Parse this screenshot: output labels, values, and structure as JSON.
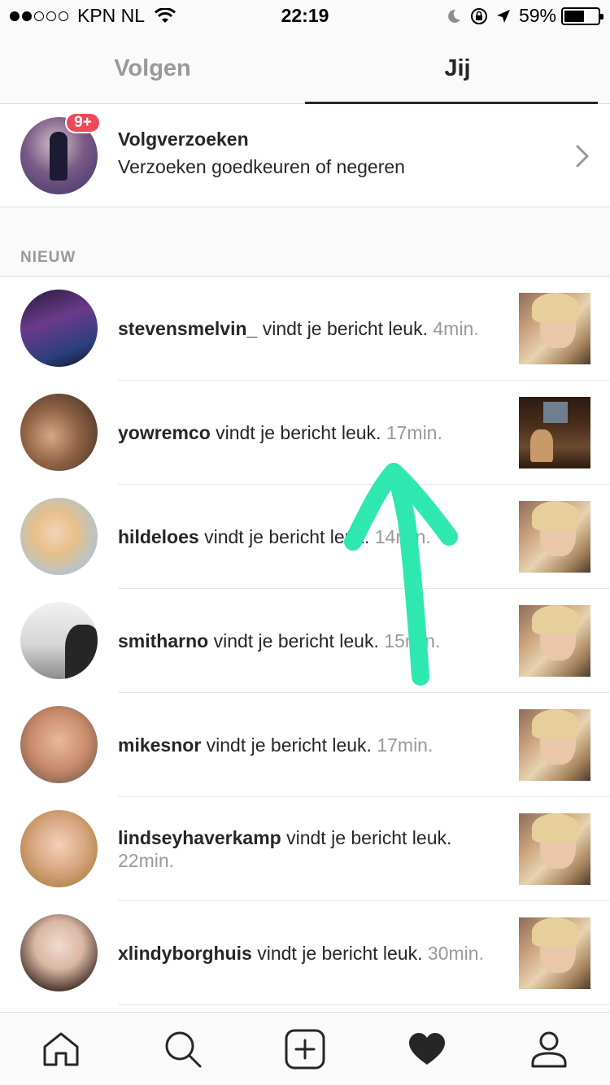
{
  "status_bar": {
    "carrier": "KPN NL",
    "time": "22:19",
    "battery": "59%",
    "battery_level": 0.59,
    "signal_bars_filled": 2,
    "signal_bars_total": 5
  },
  "tabs": [
    {
      "label": "Volgen",
      "active": false
    },
    {
      "label": "Jij",
      "active": true
    }
  ],
  "requests": {
    "badge": "9+",
    "title": "Volgverzoeken",
    "subtitle": "Verzoeken goedkeuren of negeren"
  },
  "section_label": "NIEUW",
  "activity": [
    {
      "username": "stevensmelvin_",
      "text": " vindt je bericht leuk.",
      "time": " 4min."
    },
    {
      "username": "yowremco",
      "text": " vindt je bericht leuk.",
      "time": " 17min."
    },
    {
      "username": "hildeloes",
      "text": " vindt je bericht leuk.",
      "time": " 14min."
    },
    {
      "username": "smitharno",
      "text": " vindt je bericht leuk.",
      "time": " 15min."
    },
    {
      "username": "mikesnor",
      "text": " vindt je bericht leuk.",
      "time": " 17min."
    },
    {
      "username": "lindseyhaverkamp",
      "text": " vindt je bericht leuk.",
      "time": " 22min."
    },
    {
      "username": "xlindyborghuis",
      "text": " vindt je bericht leuk.",
      "time": " 30min."
    }
  ],
  "nav": [
    {
      "icon": "home-icon"
    },
    {
      "icon": "search-icon"
    },
    {
      "icon": "add-post-icon"
    },
    {
      "icon": "heart-icon",
      "active": true
    },
    {
      "icon": "profile-icon"
    }
  ],
  "colors": {
    "badge": "#ed4956",
    "annotation_arrow": "#2ee8b0",
    "muted_text": "#999999",
    "primary_text": "#262626"
  }
}
